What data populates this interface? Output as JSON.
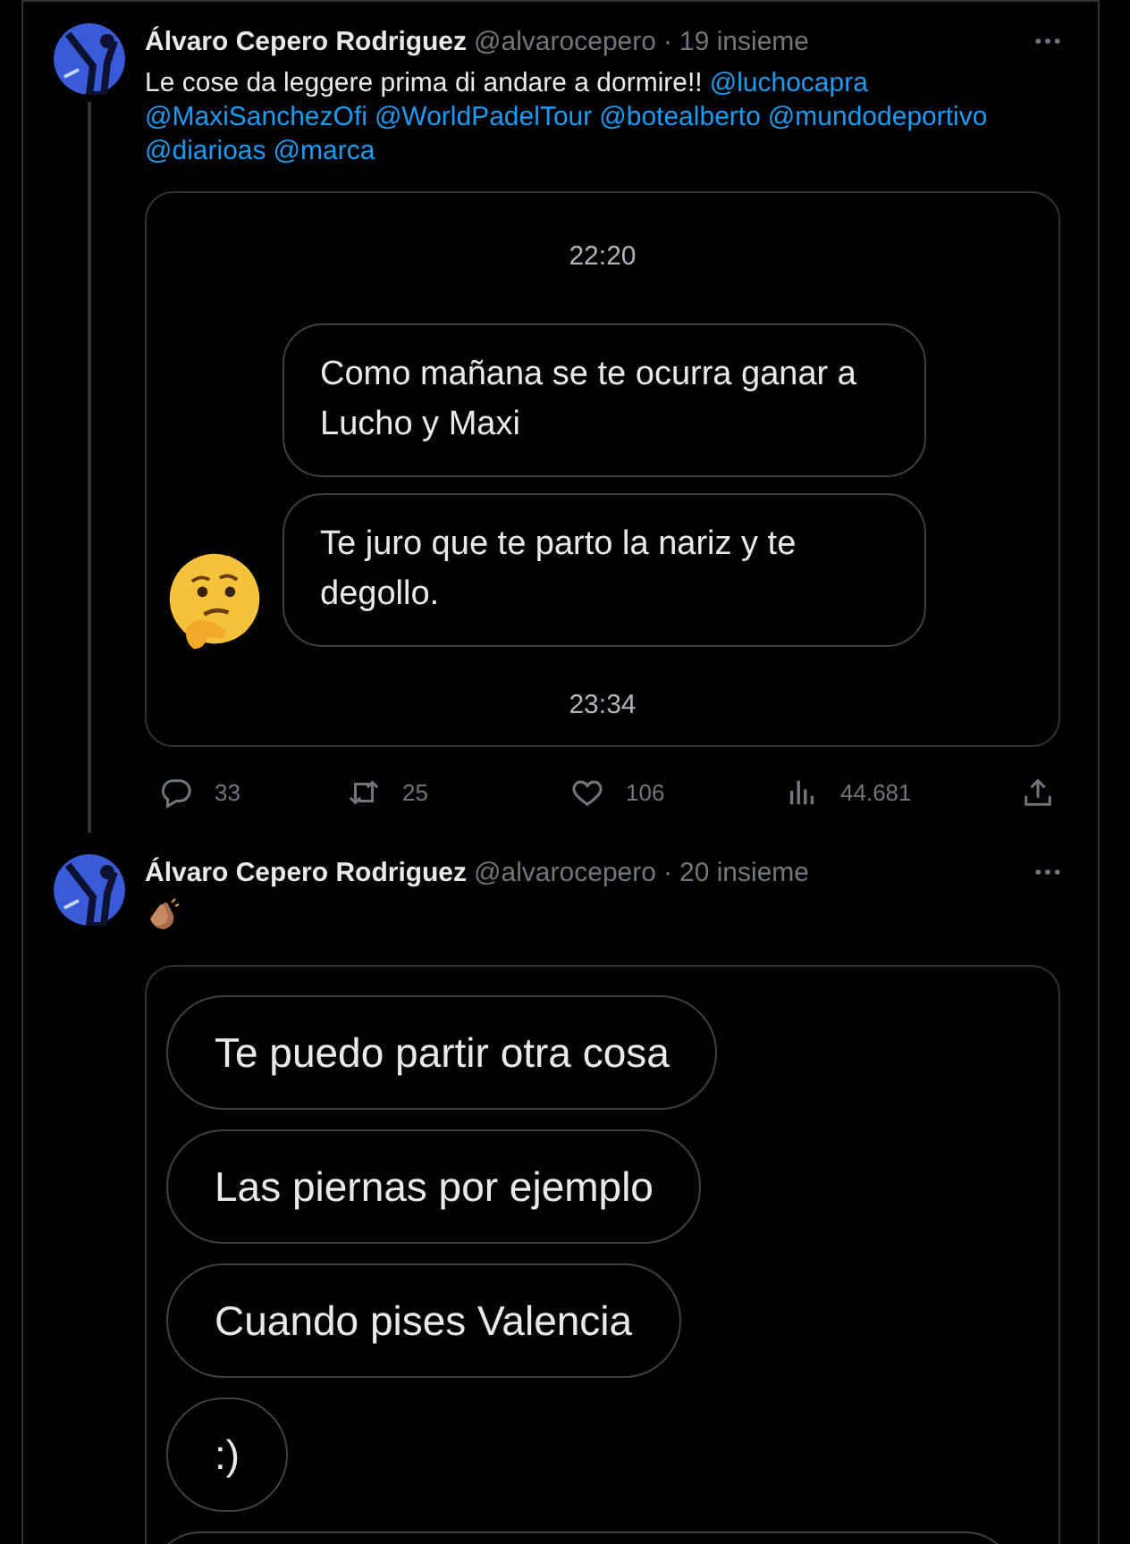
{
  "tweets": [
    {
      "author": {
        "name": "Álvaro Cepero Rodriguez",
        "handle": "@alvarocepero",
        "separator": "·",
        "time": "19 insieme"
      },
      "thread": true,
      "lines": [
        [
          {
            "kind": "text",
            "text": "Le cose da leggere prima di andare a dormire!!"
          },
          {
            "kind": "mention",
            "text": "@luchocapra"
          }
        ],
        [
          {
            "kind": "mention",
            "text": "@MaxiSanchezOfi"
          },
          {
            "kind": "mention",
            "text": "@WorldPadelTour"
          },
          {
            "kind": "mention",
            "text": "@botealberto"
          },
          {
            "kind": "mention",
            "text": "@mundodeportivo"
          }
        ],
        [
          {
            "kind": "mention",
            "text": "@diarioas"
          },
          {
            "kind": "mention",
            "text": "@marca"
          }
        ]
      ],
      "media": {
        "kind": "timed_chat",
        "items": [
          {
            "kind": "time",
            "text": "22:20"
          },
          {
            "kind": "bubble",
            "text": "Como mañana se te ocurra ganar a Lucho y Maxi",
            "emoji": false
          },
          {
            "kind": "bubble",
            "text": "Te juro que te parto la nariz y te degollo.",
            "emoji": true
          },
          {
            "kind": "time",
            "text": "23:34"
          }
        ]
      },
      "actions": [
        {
          "kind": "reply",
          "count": "33"
        },
        {
          "kind": "retweet",
          "count": "25"
        },
        {
          "kind": "like",
          "count": "106"
        },
        {
          "kind": "views",
          "count": "44.681"
        },
        {
          "kind": "share"
        }
      ]
    },
    {
      "author": {
        "name": "Álvaro Cepero Rodriguez",
        "handle": "@alvarocepero",
        "separator": "·",
        "time": "20 insieme"
      },
      "thread": false,
      "lines": [
        [
          {
            "kind": "clap"
          }
        ]
      ],
      "media": {
        "kind": "plain_chat",
        "items": [
          {
            "kind": "bubble",
            "text": "Te puedo partir otra cosa",
            "emoji": false
          },
          {
            "kind": "bubble",
            "text": "Las piernas por ejemplo",
            "emoji": false
          },
          {
            "kind": "bubble",
            "text": "Cuando pises Valencia",
            "emoji": false
          },
          {
            "kind": "bubble",
            "text": ":)",
            "emoji": false
          },
          {
            "kind": "cut_bubble"
          }
        ]
      }
    }
  ]
}
